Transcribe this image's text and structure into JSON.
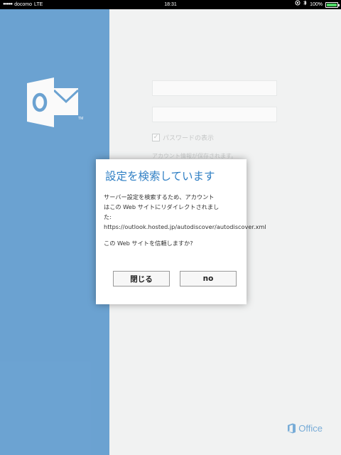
{
  "status_bar": {
    "carrier": "docomo",
    "network": "LTE",
    "time": "18:31",
    "battery": "100%",
    "battery_level": 1.0
  },
  "background": {
    "password_toggle_label": "パスワードの表示",
    "account_info_text": "アカウント情報が保存されます。",
    "brand_text": "Office",
    "left_panel_color": "#6ea6d6"
  },
  "dialog": {
    "title": "設定を検索しています",
    "message": "サーバー設定を検索するため、アカウント\nはこの Web サイトにリダイレクトされまし\nた:\nhttps://outlook.hosted.jp/autodiscover/autodiscover.xml",
    "question": "この Web サイトを信頼しますか?",
    "close_label": "閉じる",
    "no_label": "no",
    "title_color": "#2f7fc4"
  }
}
